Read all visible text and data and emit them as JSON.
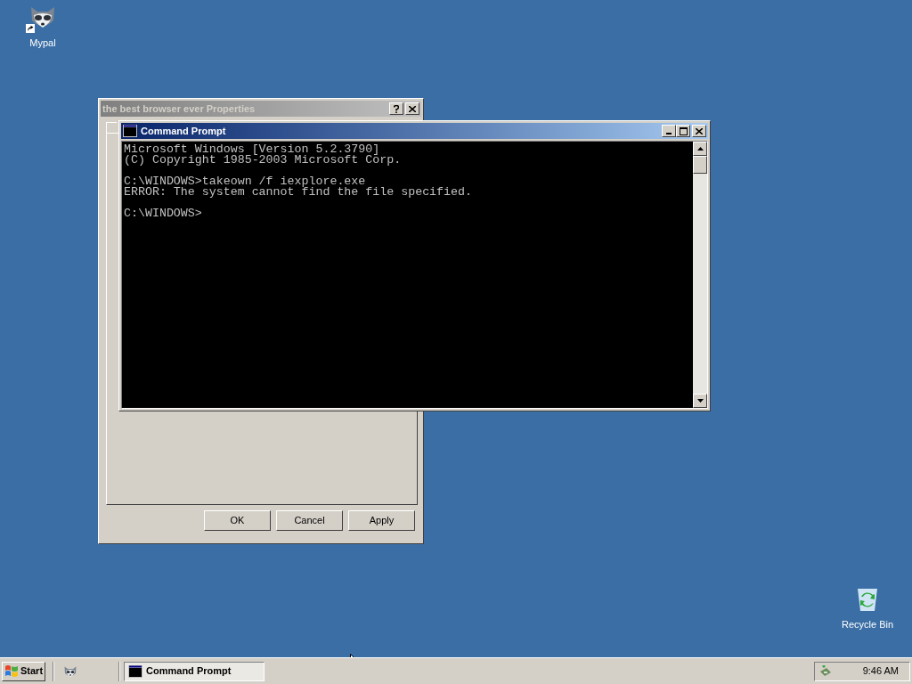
{
  "desktop_icons": [
    {
      "label": "Mypal",
      "kind": "raccoon",
      "shortcut": true
    },
    {
      "label": "Recycle Bin",
      "kind": "bin",
      "shortcut": false
    }
  ],
  "properties_dialog": {
    "title": "the best browser ever Properties",
    "active": false,
    "buttons": [
      "OK",
      "Cancel",
      "Apply"
    ]
  },
  "command_prompt": {
    "title": "Command Prompt",
    "active": true,
    "console_blocks": [
      [
        "Microsoft Windows [Version 5.2.3790]",
        "(C) Copyright 1985-2003 Microsoft Corp."
      ],
      [
        "C:\\WINDOWS>takeown /f iexplore.exe",
        "ERROR: The system cannot find the file specified."
      ],
      [
        "C:\\WINDOWS>"
      ]
    ]
  },
  "taskbar": {
    "start": "Start",
    "tasks": [
      {
        "label": "Command Prompt",
        "selected": true
      }
    ],
    "clock": "9:46 AM"
  }
}
